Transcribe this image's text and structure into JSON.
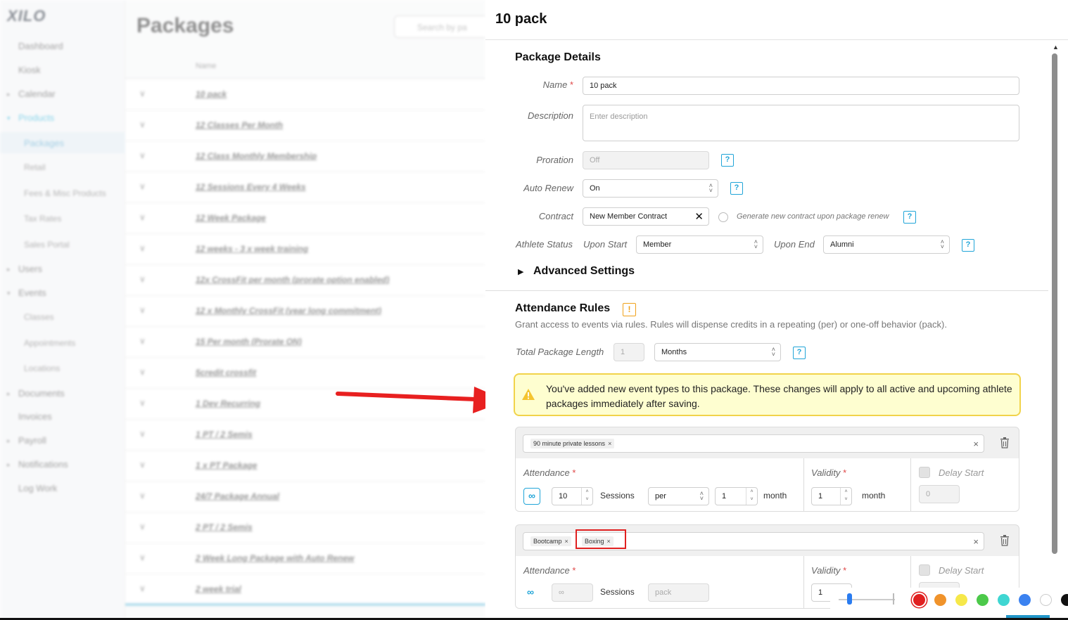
{
  "background": {
    "logo": "XILO",
    "nav": [
      {
        "label": "Dashboard"
      },
      {
        "label": "Kiosk"
      },
      {
        "label": "Calendar"
      },
      {
        "label": "Products"
      },
      {
        "label": "Packages"
      },
      {
        "label": "Retail"
      },
      {
        "label": "Fees & Misc Products"
      },
      {
        "label": "Tax Rates"
      },
      {
        "label": "Sales Portal"
      },
      {
        "label": "Users"
      },
      {
        "label": "Events"
      },
      {
        "label": "Classes"
      },
      {
        "label": "Appointments"
      },
      {
        "label": "Locations"
      },
      {
        "label": "Documents"
      },
      {
        "label": "Invoices"
      },
      {
        "label": "Payroll"
      },
      {
        "label": "Notifications"
      },
      {
        "label": "Log Work"
      }
    ],
    "page_title": "Packages",
    "search_placeholder": "Search by pa",
    "column_name": "Name",
    "rows": [
      "10 pack",
      "12 Classes Per Month",
      "12 Class Monthly Membership",
      "12 Sessions Every 4 Weeks",
      "12 Week Package",
      "12 weeks - 3 x week training",
      "12x CrossFit per month (prorate option enabled)",
      "12 x Monthly CrossFit (year long commitment)",
      "15 Per month (Prorate ON)",
      "5credit crossfit",
      "1 Dev Recurring",
      "1 PT / 2 Semis",
      "1 x PT Package",
      "24/7 Package Annual",
      "2 PT / 2 Semis",
      "2 Week Long Package with Auto Renew",
      "2 week trial"
    ]
  },
  "drawer": {
    "title": "10 pack",
    "package_details": {
      "heading": "Package Details",
      "name_label": "Name",
      "name_value": "10 pack",
      "required_mark": "*",
      "description_label": "Description",
      "description_placeholder": "Enter description",
      "proration_label": "Proration",
      "proration_value": "Off",
      "auto_renew_label": "Auto Renew",
      "auto_renew_value": "On",
      "contract_label": "Contract",
      "contract_value": "New Member Contract",
      "contract_hint": "Generate new contract upon package renew",
      "athlete_status_label": "Athlete Status",
      "upon_start_label": "Upon Start",
      "upon_start_value": "Member",
      "upon_end_label": "Upon End",
      "upon_end_value": "Alumni",
      "advanced_settings": "Advanced Settings",
      "help_glyph": "?"
    },
    "attendance_rules": {
      "heading": "Attendance Rules",
      "warn_glyph": "!",
      "description": "Grant access to events via rules. Rules will dispense credits in a repeating (per) or one-off behavior (pack).",
      "total_length_label": "Total Package Length",
      "total_length_value": "1",
      "total_length_unit": "Months",
      "alert_text": "You've added new event types to this package. These changes will apply to all active and upcoming athlete packages immediately after saving.",
      "rules": [
        {
          "tags": [
            "90 minute private lessons"
          ],
          "attendance_label": "Attendance",
          "sessions_value": "10",
          "sessions_label": "Sessions",
          "mode": "per",
          "per_value": "1",
          "per_unit": "month",
          "validity_label": "Validity",
          "validity_value": "1",
          "validity_unit": "month",
          "delay_label": "Delay Start",
          "delay_value": "0",
          "infinity": "∞"
        },
        {
          "tags": [
            "Bootcamp",
            "Boxing"
          ],
          "attendance_label": "Attendance",
          "sessions_value": "∞",
          "sessions_label": "Sessions",
          "mode": "pack",
          "validity_label": "Validity",
          "validity_value": "1",
          "delay_label": "Delay Start",
          "infinity": "∞"
        }
      ]
    }
  },
  "colors": {
    "accent": "#21a5d8",
    "alert_bg": "#fefed0",
    "alert_border": "#f1d34a",
    "annotation_red": "#e02020",
    "palette": [
      "#e02020",
      "#f0932b",
      "#f6e84a",
      "#4cc94a",
      "#3fd6d2",
      "#3b82f0",
      "#ffffff",
      "#111111"
    ]
  }
}
